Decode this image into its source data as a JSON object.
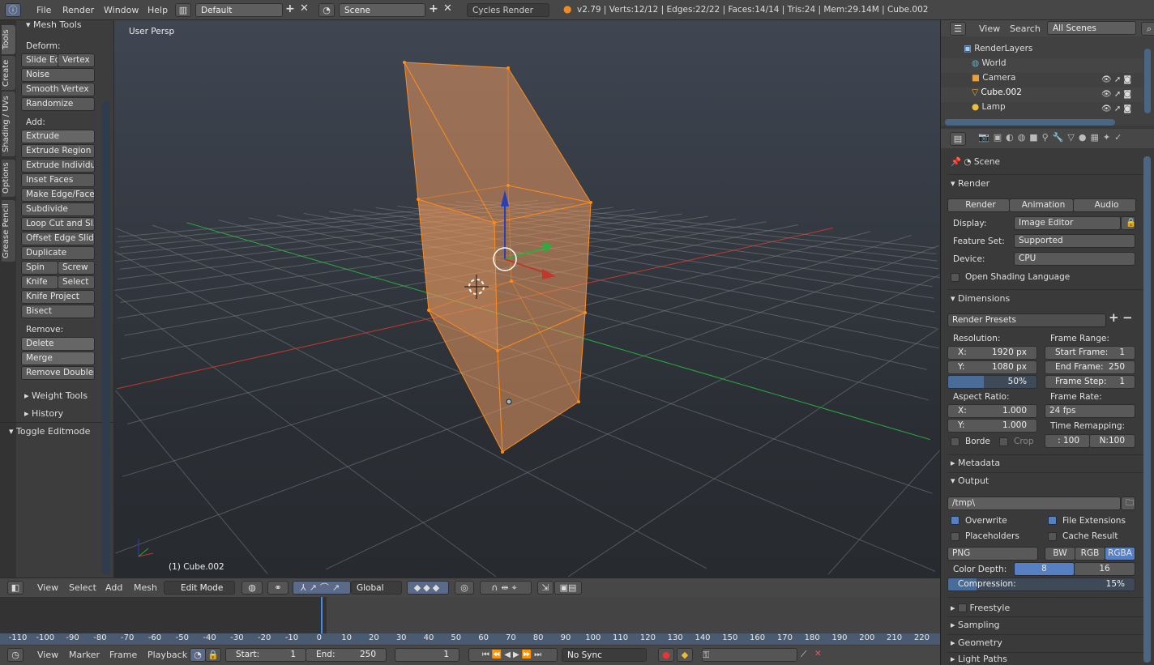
{
  "topbar": {
    "menus": [
      "File",
      "Render",
      "Window",
      "Help"
    ],
    "layout": "Default",
    "scene": "Scene",
    "engine": "Cycles Render",
    "stats": "v2.79 | Verts:12/12 | Edges:22/22 | Faces:14/14 | Tris:24 | Mem:29.14M | Cube.002"
  },
  "tool_tabs": [
    "Tools",
    "Create",
    "Shading / UVs",
    "Options",
    "Grease Pencil"
  ],
  "tools": {
    "panel_title": "Mesh Tools",
    "deform_label": "Deform:",
    "deform": [
      "Slide Ed",
      "Vertex",
      "Noise",
      "Smooth Vertex",
      "Randomize"
    ],
    "add_label": "Add:",
    "add": [
      "Extrude",
      "Extrude Region",
      "Extrude Individual",
      "Inset Faces",
      "Make Edge/Face",
      "Subdivide",
      "Loop Cut and Sl...",
      "Offset Edge Slide",
      "Duplicate",
      "Spin",
      "Screw",
      "Knife",
      "Select",
      "Knife Project",
      "Bisect"
    ],
    "remove_label": "Remove:",
    "remove": [
      "Delete",
      "Merge",
      "Remove Doubles"
    ],
    "weight_tools": "Weight Tools",
    "history": "History",
    "toggle_editmode": "Toggle Editmode"
  },
  "viewport": {
    "view_name": "User Persp",
    "object_label": "(1) Cube.002",
    "colors": {
      "mesh_fill": "#e8985e",
      "mesh_edge": "#ff8c1a",
      "x_axis": "#c0392b",
      "y_axis": "#27ae3c",
      "z_axis": "#2b3fb5"
    }
  },
  "outliner": {
    "menus": [
      "View",
      "Search"
    ],
    "filter": "All Scenes",
    "items": [
      "RenderLayers",
      "World",
      "Camera",
      "Cube.002",
      "Lamp"
    ]
  },
  "properties": {
    "context": "Scene",
    "render": {
      "title": "Render",
      "buttons": [
        "Render",
        "Animation",
        "Audio"
      ],
      "display_label": "Display:",
      "display": "Image Editor",
      "feature_label": "Feature Set:",
      "feature": "Supported",
      "device_label": "Device:",
      "device": "CPU",
      "osl": "Open Shading Language"
    },
    "dimensions": {
      "title": "Dimensions",
      "presets": "Render Presets",
      "resolution_label": "Resolution:",
      "res_x": "1920 px",
      "res_y": "1080 px",
      "res_pct": "50%",
      "res_pct_value": 50,
      "aspect_label": "Aspect Ratio:",
      "aspect_x": "1.000",
      "aspect_y": "1.000",
      "border": "Borde",
      "crop": "Crop",
      "frame_range_label": "Frame Range:",
      "start_frame_label": "Start Frame:",
      "start_frame": "1",
      "end_frame_label": "End Frame:",
      "end_frame": "250",
      "frame_step_label": "Frame Step:",
      "frame_step": "1",
      "frame_rate_label": "Frame Rate:",
      "frame_rate": "24 fps",
      "time_remap_label": "Time Remapping:",
      "remap_old": ": 100",
      "remap_new": "N:100",
      "x_label": "X:",
      "y_label": "Y:"
    },
    "metadata": "Metadata",
    "output": {
      "title": "Output",
      "path": "/tmp\\",
      "overwrite": "Overwrite",
      "file_ext": "File Extensions",
      "placeholders": "Placeholders",
      "cache": "Cache Result",
      "format": "PNG",
      "modes": [
        "BW",
        "RGB",
        "RGBA"
      ],
      "color_depth_label": "Color Depth:",
      "depths": [
        "8",
        "16"
      ],
      "compression_label": "Compression:",
      "compression": "15%",
      "compression_value": 15
    },
    "collapsed": [
      "Freestyle",
      "Sampling",
      "Geometry",
      "Light Paths"
    ]
  },
  "view3d_header": {
    "menus": [
      "View",
      "Select",
      "Add",
      "Mesh"
    ],
    "mode": "Edit Mode",
    "orientation": "Global"
  },
  "timeline": {
    "ticks": [
      "-110",
      "-100",
      "-90",
      "-80",
      "-70",
      "-60",
      "-50",
      "-40",
      "-30",
      "-20",
      "-10",
      "0",
      "10",
      "20",
      "30",
      "40",
      "50",
      "60",
      "70",
      "80",
      "90",
      "100",
      "110",
      "120",
      "130",
      "140",
      "150",
      "160",
      "170",
      "180",
      "190",
      "200",
      "210",
      "220"
    ],
    "current_frame": 1,
    "menus": [
      "View",
      "Marker",
      "Frame",
      "Playback"
    ],
    "start_label": "Start:",
    "start": "1",
    "end_label": "End:",
    "end": "250",
    "frame": "1",
    "sync": "No Sync"
  }
}
